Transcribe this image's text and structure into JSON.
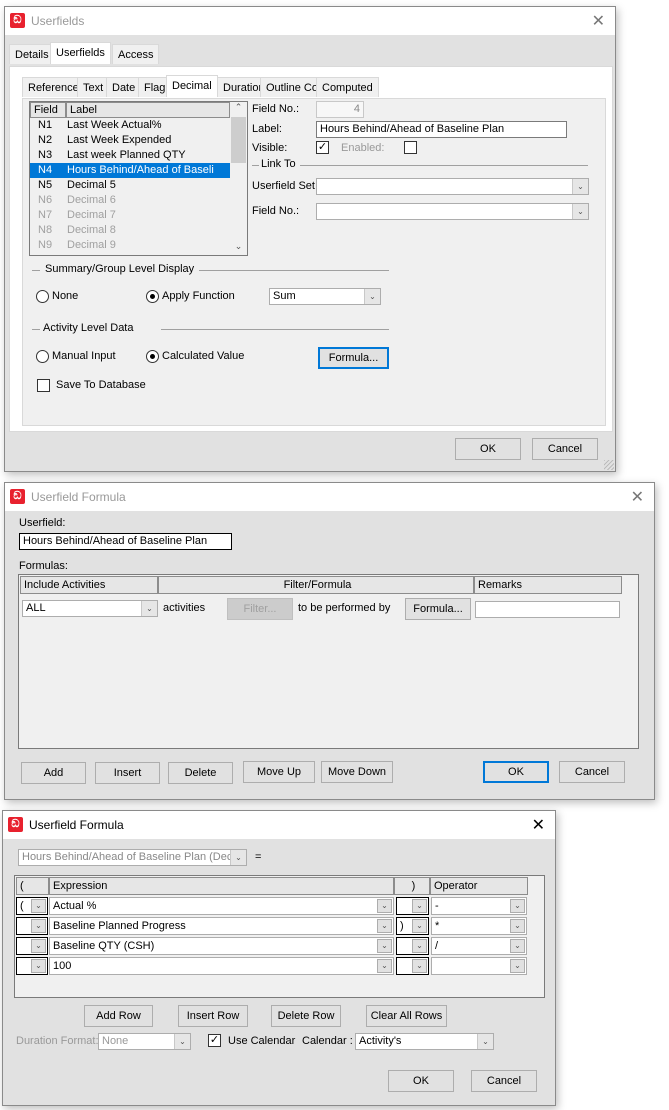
{
  "dialog1": {
    "title": "Userfields",
    "tabs": [
      "Details",
      "Userfields",
      "Access"
    ],
    "active_tab": "Userfields",
    "subtabs": [
      "Reference",
      "Text",
      "Date",
      "Flag",
      "Decimal",
      "Duration",
      "Outline Codes",
      "Computed"
    ],
    "active_subtab": "Decimal",
    "list": {
      "headers": {
        "field": "Field",
        "label": "Label"
      },
      "rows": [
        {
          "field": "N1",
          "label": "Last Week Actual%",
          "state": "normal"
        },
        {
          "field": "N2",
          "label": "Last Week Expended",
          "state": "normal"
        },
        {
          "field": "N3",
          "label": "Last week Planned QTY",
          "state": "normal"
        },
        {
          "field": "N4",
          "label": "Hours Behind/Ahead of Baseli",
          "state": "selected"
        },
        {
          "field": "N5",
          "label": "Decimal 5",
          "state": "normal"
        },
        {
          "field": "N6",
          "label": "Decimal 6",
          "state": "dim"
        },
        {
          "field": "N7",
          "label": "Decimal 7",
          "state": "dim"
        },
        {
          "field": "N8",
          "label": "Decimal 8",
          "state": "dim"
        },
        {
          "field": "N9",
          "label": "Decimal 9",
          "state": "dim"
        }
      ]
    },
    "field_no_label": "Field No.:",
    "field_no_value": "4",
    "label_label": "Label:",
    "label_value": "Hours Behind/Ahead of Baseline Plan",
    "visible_label": "Visible:",
    "visible_checked": true,
    "enabled_label": "Enabled:",
    "enabled_checked": false,
    "link_to_label": "Link To",
    "userfield_set_label": "Userfield Set:",
    "userfield_set_value": "",
    "link_field_no_label": "Field No.:",
    "link_field_no_value": "",
    "summary_group_label": "Summary/Group Level Display",
    "none_label": "None",
    "apply_function_label": "Apply Function",
    "function_value": "Sum",
    "activity_level_label": "Activity Level Data",
    "manual_input_label": "Manual Input",
    "calculated_value_label": "Calculated Value",
    "formula_button": "Formula...",
    "save_to_db_label": "Save To Database",
    "save_to_db_checked": false,
    "ok": "OK",
    "cancel": "Cancel"
  },
  "dialog2": {
    "title": "Userfield Formula",
    "userfield_label": "Userfield:",
    "userfield_value": "Hours Behind/Ahead of Baseline Plan",
    "formulas_label": "Formulas:",
    "headers": [
      "Include Activities",
      "Filter/Formula",
      "Remarks"
    ],
    "row": {
      "include": "ALL",
      "activities_text": "activities",
      "filter_button": "Filter...",
      "performed_text": "to be performed by",
      "formula_button": "Formula...",
      "remarks": ""
    },
    "buttons": {
      "add": "Add",
      "insert": "Insert",
      "delete": "Delete",
      "move_up": "Move Up",
      "move_down": "Move Down",
      "ok": "OK",
      "cancel": "Cancel"
    }
  },
  "dialog3": {
    "title": "Userfield Formula",
    "target_value": "Hours Behind/Ahead of Baseline Plan (Deci",
    "equals": "=",
    "headers": {
      "open": "(",
      "expression": "Expression",
      "close": ")",
      "operator": "Operator"
    },
    "rows": [
      {
        "open": "(",
        "expression": "Actual %",
        "close": "",
        "operator": "-"
      },
      {
        "open": "",
        "expression": "Baseline Planned Progress",
        "close": ")",
        "operator": "*"
      },
      {
        "open": "",
        "expression": "Baseline QTY (CSH)",
        "close": "",
        "operator": "/"
      },
      {
        "open": "",
        "expression": "100",
        "close": "",
        "operator": ""
      }
    ],
    "buttons": {
      "add_row": "Add Row",
      "insert_row": "Insert Row",
      "delete_row": "Delete Row",
      "clear_all_rows": "Clear All Rows",
      "ok": "OK",
      "cancel": "Cancel"
    },
    "duration_format_label": "Duration Format:",
    "duration_format_value": "None",
    "use_calendar_label": "Use Calendar",
    "use_calendar_checked": true,
    "calendar_label": "Calendar :",
    "calendar_value": "Activity's"
  }
}
